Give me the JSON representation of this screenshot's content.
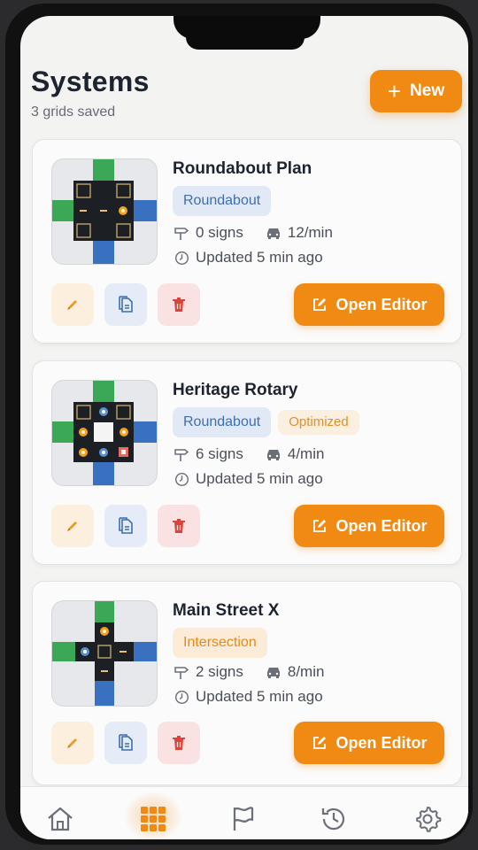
{
  "header": {
    "title": "Systems",
    "subtitle": "3 grids saved",
    "new_button": "New"
  },
  "cards": [
    {
      "title": "Roundabout Plan",
      "tags": [
        "Roundabout"
      ],
      "signs": "0 signs",
      "rate": "12/min",
      "updated": "Updated 5 min ago",
      "open_label": "Open Editor"
    },
    {
      "title": "Heritage Rotary",
      "tags": [
        "Roundabout",
        "Optimized"
      ],
      "signs": "6 signs",
      "rate": "4/min",
      "updated": "Updated 5 min ago",
      "open_label": "Open Editor"
    },
    {
      "title": "Main Street X",
      "tags": [
        "Intersection"
      ],
      "signs": "2 signs",
      "rate": "8/min",
      "updated": "Updated 5 min ago",
      "open_label": "Open Editor"
    }
  ],
  "tabbar": {
    "items": [
      "home-icon",
      "grid-icon",
      "flag-icon",
      "history-icon",
      "gear-icon"
    ],
    "active": "grid-icon"
  },
  "colors": {
    "accent": "#f08a12",
    "road_green": "#3aa856",
    "road_blue": "#3a70c0",
    "tag_blue": "#3d6fb2",
    "delete_red": "#d9453b"
  }
}
